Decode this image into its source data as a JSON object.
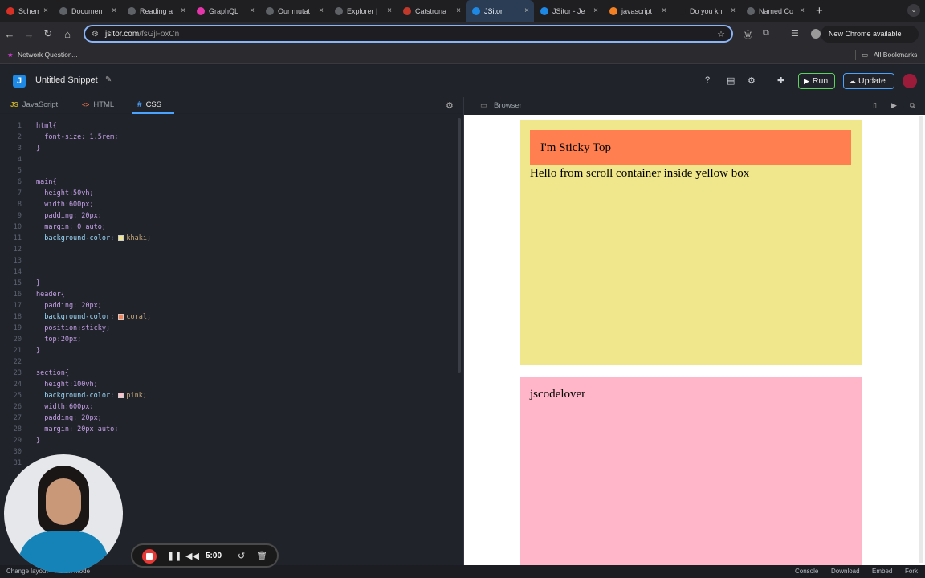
{
  "browser": {
    "tabs": [
      {
        "label": "Schemas",
        "icon": "record-icon",
        "fav_color": "#d93025"
      },
      {
        "label": "Documen",
        "icon": "anthropic-icon",
        "fav_color": "#5f6368"
      },
      {
        "label": "Reading a",
        "icon": "anthropic-icon",
        "fav_color": "#5f6368"
      },
      {
        "label": "GraphQL",
        "icon": "graphql-icon",
        "fav_color": "#e535ab"
      },
      {
        "label": "Our mutat",
        "icon": "anthropic-icon",
        "fav_color": "#5f6368"
      },
      {
        "label": "Explorer |",
        "icon": "anthropic-icon",
        "fav_color": "#5f6368"
      },
      {
        "label": "Catstrona",
        "icon": "cat-icon",
        "fav_color": "#c0392b"
      },
      {
        "label": "JSitor",
        "icon": "jsitor-icon",
        "fav_color": "#1e88e5",
        "active": true
      },
      {
        "label": "JSitor - Je",
        "icon": "jsitor-icon",
        "fav_color": "#1e88e5"
      },
      {
        "label": "javascript",
        "icon": "stackoverflow-icon",
        "fav_color": "#f48024"
      },
      {
        "label": "Do you kn",
        "icon": "globe-icon",
        "fav_color": "#1f1f22"
      },
      {
        "label": "Named Co",
        "icon": "globe-icon",
        "fav_color": "#5f6368"
      }
    ],
    "url_host": "jsitor.com",
    "url_path": "/fsGjFoxCn",
    "new_chrome_label": "New Chrome available",
    "bookmark_label": "Network Question...",
    "all_bookmarks_label": "All Bookmarks"
  },
  "app": {
    "snippet_title": "Untitled Snippet",
    "run_label": "Run",
    "update_label": "Update",
    "editor_tabs": [
      {
        "label": "JavaScript",
        "icon": "JS"
      },
      {
        "label": "HTML",
        "icon": "<>"
      },
      {
        "label": "CSS",
        "icon": "#",
        "active": true
      }
    ],
    "browser_panel_title": "Browser"
  },
  "code_lines": [
    {
      "n": "1",
      "t": "html{"
    },
    {
      "n": "2",
      "t": "  font-size: 1.5rem;"
    },
    {
      "n": "3",
      "t": "}"
    },
    {
      "n": "4",
      "t": ""
    },
    {
      "n": "5",
      "t": ""
    },
    {
      "n": "6",
      "t": "main{"
    },
    {
      "n": "7",
      "t": "  height:50vh;"
    },
    {
      "n": "8",
      "t": "  width:600px;"
    },
    {
      "n": "9",
      "t": "  padding: 20px;"
    },
    {
      "n": "10",
      "t": "  margin: 0 auto;"
    },
    {
      "n": "11",
      "t": "  background-color: khaki;",
      "swatch": "#f0e68c"
    },
    {
      "n": "12",
      "t": ""
    },
    {
      "n": "13",
      "t": ""
    },
    {
      "n": "14",
      "t": ""
    },
    {
      "n": "15",
      "t": "}"
    },
    {
      "n": "16",
      "t": "header{"
    },
    {
      "n": "17",
      "t": "  padding: 20px;"
    },
    {
      "n": "18",
      "t": "  background-color: coral;",
      "swatch": "#ff7f50"
    },
    {
      "n": "19",
      "t": "  position:sticky;"
    },
    {
      "n": "20",
      "t": "  top:20px;"
    },
    {
      "n": "21",
      "t": "}"
    },
    {
      "n": "22",
      "t": ""
    },
    {
      "n": "23",
      "t": "section{"
    },
    {
      "n": "24",
      "t": "  height:100vh;"
    },
    {
      "n": "25",
      "t": "  background-color: pink;",
      "swatch": "#ffc0cb"
    },
    {
      "n": "26",
      "t": "  width:600px;"
    },
    {
      "n": "27",
      "t": "  padding: 20px;"
    },
    {
      "n": "28",
      "t": "  margin: 20px auto;"
    },
    {
      "n": "29",
      "t": "}"
    },
    {
      "n": "30",
      "t": ""
    },
    {
      "n": "31",
      "t": ""
    }
  ],
  "preview": {
    "sticky_text": "I'm Sticky Top",
    "hello_text": "Hello from scroll container inside yellow box",
    "section_text": "jscodelover"
  },
  "recorder": {
    "time": "5:00"
  },
  "status": {
    "change_layout": "Change layout",
    "zen_mode": "Zen mode",
    "console": "Console",
    "download": "Download",
    "embed": "Embed",
    "fork": "Fork"
  },
  "colors": {
    "khaki": "#f0e68c",
    "coral": "#ff7f50",
    "pink": "#ffb6c8",
    "accent": "#4aa3ff",
    "run_border": "#5bd45b"
  }
}
